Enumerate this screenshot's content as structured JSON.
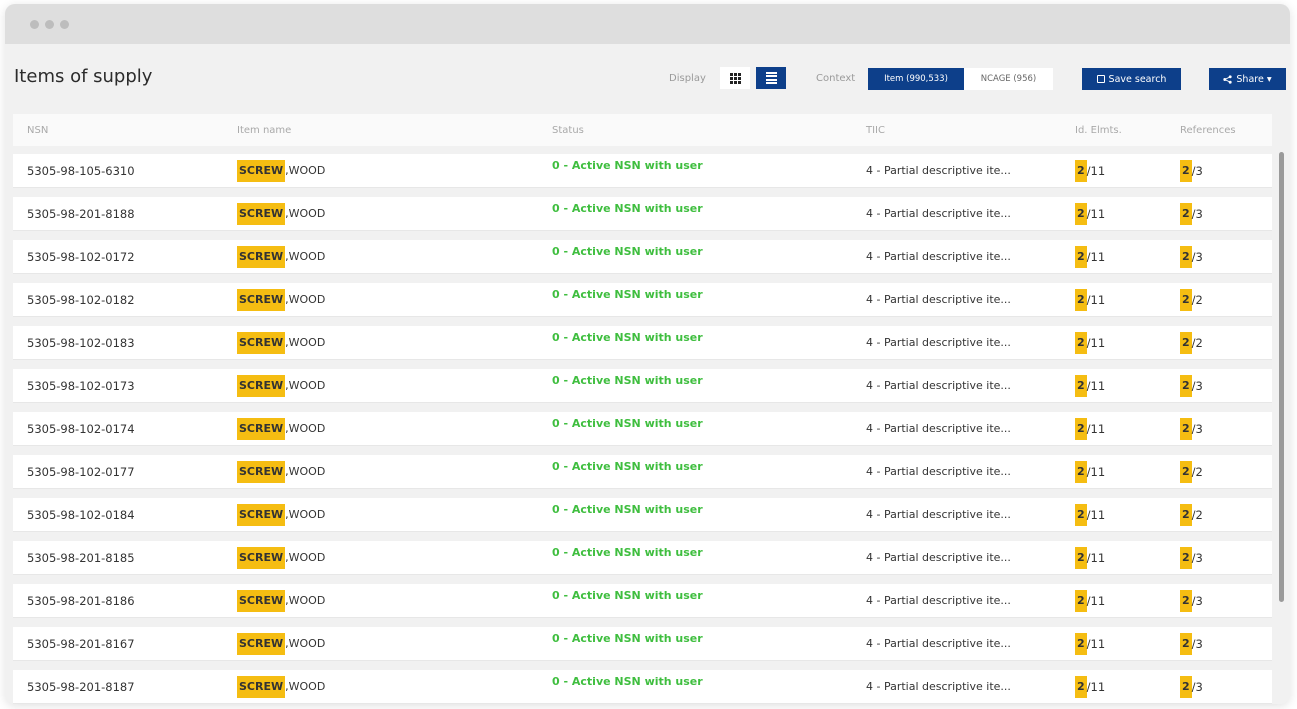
{
  "page": {
    "title": "Items of supply"
  },
  "display": {
    "label": "Display",
    "grid_icon": "grid-view-icon",
    "list_icon": "list-view-icon"
  },
  "context": {
    "label": "Context",
    "item_tab": "Item (990,533)",
    "ncage_tab": "NCAGE (956)"
  },
  "actions": {
    "save_search": "Save search",
    "share": "Share ▾"
  },
  "table": {
    "columns": [
      "NSN",
      "Item name",
      "Status",
      "TIIC",
      "Id. Elmts.",
      "References"
    ],
    "rows": [
      {
        "nsn": "5305-98-105-6310",
        "hl": "SCREW",
        "rest": ",WOOD",
        "status": "0 - Active NSN with user",
        "tiic": "4 - Partial descriptive ite...",
        "id_num": "2",
        "id_rest": "/11",
        "ref_num": "2",
        "ref_rest": "/3"
      },
      {
        "nsn": "5305-98-201-8188",
        "hl": "SCREW",
        "rest": ",WOOD",
        "status": "0 - Active NSN with user",
        "tiic": "4 - Partial descriptive ite...",
        "id_num": "2",
        "id_rest": "/11",
        "ref_num": "2",
        "ref_rest": "/3"
      },
      {
        "nsn": "5305-98-102-0172",
        "hl": "SCREW",
        "rest": ",WOOD",
        "status": "0 - Active NSN with user",
        "tiic": "4 - Partial descriptive ite...",
        "id_num": "2",
        "id_rest": "/11",
        "ref_num": "2",
        "ref_rest": "/3"
      },
      {
        "nsn": "5305-98-102-0182",
        "hl": "SCREW",
        "rest": ",WOOD",
        "status": "0 - Active NSN with user",
        "tiic": "4 - Partial descriptive ite...",
        "id_num": "2",
        "id_rest": "/11",
        "ref_num": "2",
        "ref_rest": "/2"
      },
      {
        "nsn": "5305-98-102-0183",
        "hl": "SCREW",
        "rest": ",WOOD",
        "status": "0 - Active NSN with user",
        "tiic": "4 - Partial descriptive ite...",
        "id_num": "2",
        "id_rest": "/11",
        "ref_num": "2",
        "ref_rest": "/2"
      },
      {
        "nsn": "5305-98-102-0173",
        "hl": "SCREW",
        "rest": ",WOOD",
        "status": "0 - Active NSN with user",
        "tiic": "4 - Partial descriptive ite...",
        "id_num": "2",
        "id_rest": "/11",
        "ref_num": "2",
        "ref_rest": "/3"
      },
      {
        "nsn": "5305-98-102-0174",
        "hl": "SCREW",
        "rest": ",WOOD",
        "status": "0 - Active NSN with user",
        "tiic": "4 - Partial descriptive ite...",
        "id_num": "2",
        "id_rest": "/11",
        "ref_num": "2",
        "ref_rest": "/3"
      },
      {
        "nsn": "5305-98-102-0177",
        "hl": "SCREW",
        "rest": ",WOOD",
        "status": "0 - Active NSN with user",
        "tiic": "4 - Partial descriptive ite...",
        "id_num": "2",
        "id_rest": "/11",
        "ref_num": "2",
        "ref_rest": "/2"
      },
      {
        "nsn": "5305-98-102-0184",
        "hl": "SCREW",
        "rest": ",WOOD",
        "status": "0 - Active NSN with user",
        "tiic": "4 - Partial descriptive ite...",
        "id_num": "2",
        "id_rest": "/11",
        "ref_num": "2",
        "ref_rest": "/2"
      },
      {
        "nsn": "5305-98-201-8185",
        "hl": "SCREW",
        "rest": ",WOOD",
        "status": "0 - Active NSN with user",
        "tiic": "4 - Partial descriptive ite...",
        "id_num": "2",
        "id_rest": "/11",
        "ref_num": "2",
        "ref_rest": "/3"
      },
      {
        "nsn": "5305-98-201-8186",
        "hl": "SCREW",
        "rest": ",WOOD",
        "status": "0 - Active NSN with user",
        "tiic": "4 - Partial descriptive ite...",
        "id_num": "2",
        "id_rest": "/11",
        "ref_num": "2",
        "ref_rest": "/3"
      },
      {
        "nsn": "5305-98-201-8167",
        "hl": "SCREW",
        "rest": ",WOOD",
        "status": "0 - Active NSN with user",
        "tiic": "4 - Partial descriptive ite...",
        "id_num": "2",
        "id_rest": "/11",
        "ref_num": "2",
        "ref_rest": "/3"
      },
      {
        "nsn": "5305-98-201-8187",
        "hl": "SCREW",
        "rest": ",WOOD",
        "status": "0 - Active NSN with user",
        "tiic": "4 - Partial descriptive ite...",
        "id_num": "2",
        "id_rest": "/11",
        "ref_num": "2",
        "ref_rest": "/3"
      }
    ]
  },
  "colors": {
    "accent": "#0d3f8a",
    "highlight": "#f5bd12",
    "status_green": "#3fbe3f"
  }
}
